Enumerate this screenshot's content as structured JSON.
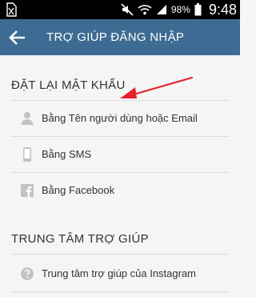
{
  "status_bar": {
    "battery": "98%",
    "time": "9:48"
  },
  "app_bar": {
    "title": "TRỢ GIÚP ĐĂNG NHẬP"
  },
  "reset_section": {
    "header": "ĐẶT LẠI MẬT KHẨU",
    "items": [
      {
        "label": "Bằng Tên người dùng hoặc Email",
        "icon": "person-icon"
      },
      {
        "label": "Bằng SMS",
        "icon": "phone-icon"
      },
      {
        "label": "Bằng Facebook",
        "icon": "facebook-icon"
      }
    ]
  },
  "help_section": {
    "header": "TRUNG TÂM TRỢ GIÚP",
    "items": [
      {
        "label": "Trung tâm trợ giúp của Instagram",
        "icon": "help-icon"
      }
    ]
  },
  "colors": {
    "app_bar": "#3d6b93",
    "annotation_arrow": "#e8202a"
  }
}
